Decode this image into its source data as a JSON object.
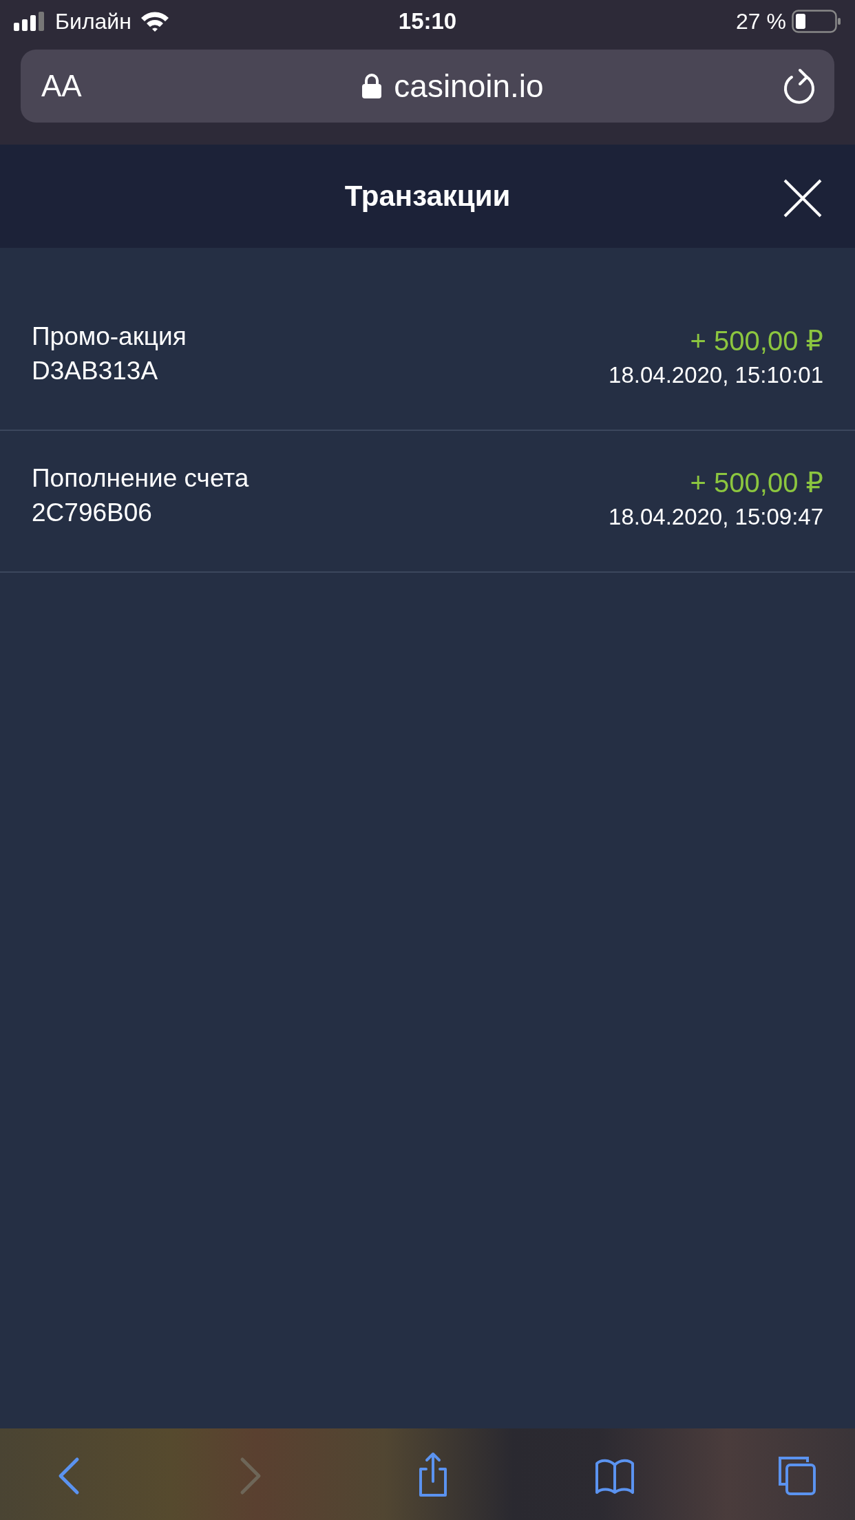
{
  "status_bar": {
    "carrier": "Билайн",
    "time": "15:10",
    "battery": "27 %"
  },
  "address_bar": {
    "text_size": "AA",
    "url": "casinoin.io"
  },
  "header": {
    "title": "Транзакции"
  },
  "transactions": [
    {
      "title": "Промо-акция",
      "code": "D3AB313A",
      "amount": "+ 500,00 ₽",
      "date": "18.04.2020, 15:10:01"
    },
    {
      "title": "Пополнение счета",
      "code": "2C796B06",
      "amount": "+ 500,00 ₽",
      "date": "18.04.2020, 15:09:47"
    }
  ],
  "toolbar": [
    {
      "kind": "back",
      "disabled": false
    },
    {
      "kind": "forward",
      "disabled": true
    },
    {
      "kind": "share",
      "disabled": false
    },
    {
      "kind": "bookmarks",
      "disabled": false
    },
    {
      "kind": "tabs",
      "disabled": false
    }
  ]
}
